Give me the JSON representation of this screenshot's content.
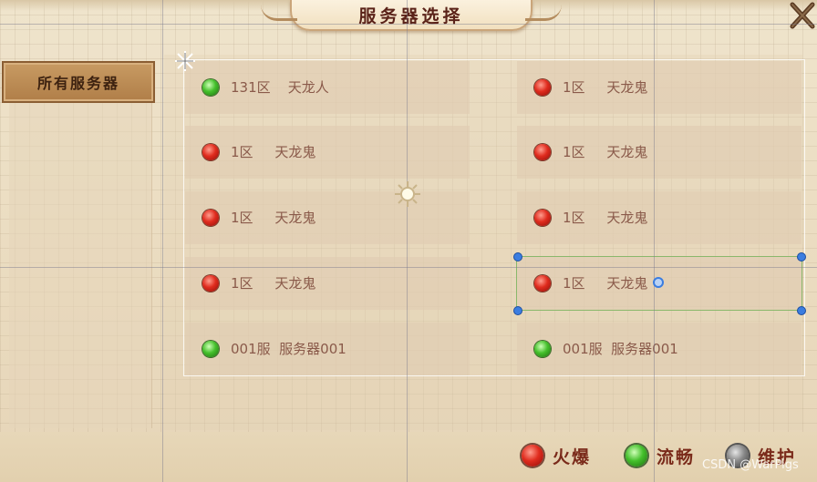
{
  "window": {
    "title": "服务器选择"
  },
  "sidebar": {
    "tabs": [
      {
        "label": "所有服务器"
      }
    ]
  },
  "servers": [
    {
      "label": "131区    天龙人",
      "status": "green"
    },
    {
      "label": "1区     天龙鬼",
      "status": "red"
    },
    {
      "label": "1区     天龙鬼",
      "status": "red"
    },
    {
      "label": "1区     天龙鬼",
      "status": "red"
    },
    {
      "label": "1区     天龙鬼",
      "status": "red"
    },
    {
      "label": "1区     天龙鬼",
      "status": "red"
    },
    {
      "label": "1区     天龙鬼",
      "status": "red"
    },
    {
      "label": "1区     天龙鬼",
      "status": "red"
    },
    {
      "label": "001服  服务器001",
      "status": "green"
    },
    {
      "label": "001服  服务器001",
      "status": "green"
    }
  ],
  "legend": [
    {
      "label": "火爆",
      "status": "red"
    },
    {
      "label": "流畅",
      "status": "green"
    },
    {
      "label": "维护",
      "status": "gray"
    }
  ],
  "watermark": "CSDN @WarPigs",
  "colors": {
    "hot": "#e02c1e",
    "smooth": "#45c02c",
    "maintenance": "#8a8a8a",
    "title_text": "#5a2218"
  }
}
